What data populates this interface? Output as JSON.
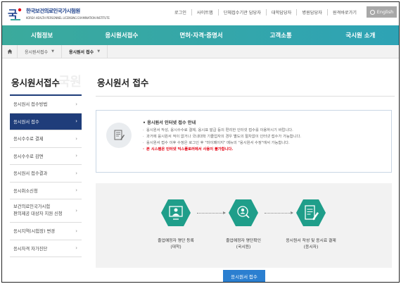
{
  "header": {
    "logo_text": "한국보건의료인국가시험원",
    "logo_subtext": "KOREA HEALTH PERSONNEL LICENSING EXAMINATION INSTITUTE",
    "util_links": [
      "로그인",
      "사이트맵",
      "단체접수기관 담당자",
      "대학담당자",
      "병원담당자",
      "원격바로가기"
    ],
    "english_label": "English"
  },
  "gnb": {
    "items": [
      "시험정보",
      "응시원서접수",
      "면허·자격·증명서",
      "고객소통",
      "국시원 소개"
    ]
  },
  "breadcrumb": {
    "items": [
      "응시원서접수",
      "응시원서 접수"
    ]
  },
  "sidebar": {
    "title": "응시원서접수",
    "watermark": "국원",
    "items": [
      {
        "label": "응시원서 접수방법",
        "active": false
      },
      {
        "label": "응시원서 접수",
        "active": true
      },
      {
        "label": "응시수수료 결제",
        "active": false
      },
      {
        "label": "응시수수료 감면",
        "active": false
      },
      {
        "label": "응시원서 접수결과",
        "active": false
      },
      {
        "label": "응시취소신청",
        "active": false
      },
      {
        "label": "보건의료인국가시험\n편의제공 대상자 지원 신청",
        "active": false
      },
      {
        "label": "응시지역(시험장) 변경",
        "active": false
      },
      {
        "label": "응시자격 자가진단",
        "active": false
      }
    ]
  },
  "main": {
    "title": "응시원서 접수",
    "notice": {
      "heading": "• 응시원서 인터넷 접수 안내",
      "lines": [
        "응시원서 작성, 응시수수료 결제, 응시표 발급 등의 편리한 인터넷 접수를 이용하시기 바랍니다.",
        "과거에 응시원서 적이 없거나 국내대학 기졸업자의 경우 별도의 절차없이 인터넷 접수가 가능합니다.",
        "응시원서 접수 이후 수정은 로그인 후 \"마이페이지\" 메뉴의 \"응시원서 수정\"에서 가능합니다."
      ],
      "warning": "본 시스템은 인터넷 익스플로러에서 사용이 불가합니다."
    },
    "steps": [
      {
        "label": "졸업예정자 명단 등록\n(대학)"
      },
      {
        "label": "졸업예정자 명단확인\n(국시원)"
      },
      {
        "label": "응시원서 작성 및 응시료 결제\n(응시자)"
      }
    ],
    "submit_label": "응시원서 접수"
  },
  "colors": {
    "gnb_start": "#3baa9c",
    "gnb_end": "#2ea3b5",
    "sidebar_active": "#1f3d7a",
    "step_hex": "#1f9e8a",
    "submit_button": "#2b7fd0",
    "warning_text": "#e60012"
  }
}
